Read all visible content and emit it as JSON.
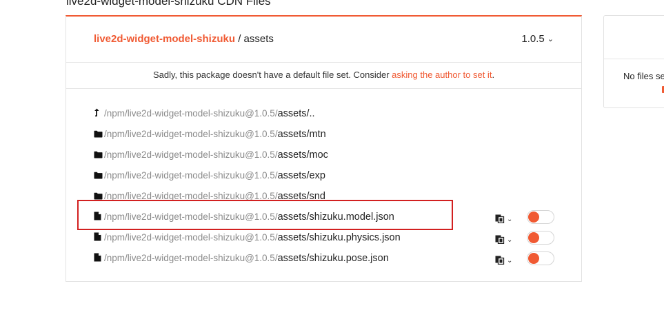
{
  "page": {
    "title": "live2d-widget-model-shizuku CDN Files"
  },
  "header": {
    "package_name": "live2d-widget-model-shizuku",
    "separator": " / ",
    "folder": "assets",
    "version": "1.0.5"
  },
  "notice": {
    "text": "Sadly, this package doesn't have a default file set. Consider ",
    "link_text": "asking the author to set it",
    "suffix": "."
  },
  "files": [
    {
      "type": "parent",
      "icon": "level-up-icon",
      "prefix": "/npm/live2d-widget-model-shizuku@1.0.5/",
      "name": "assets/.."
    },
    {
      "type": "folder",
      "icon": "folder-icon",
      "prefix": "/npm/live2d-widget-model-shizuku@1.0.5/",
      "name": "assets/mtn"
    },
    {
      "type": "folder",
      "icon": "folder-icon",
      "prefix": "/npm/live2d-widget-model-shizuku@1.0.5/",
      "name": "assets/moc"
    },
    {
      "type": "folder",
      "icon": "folder-icon",
      "prefix": "/npm/live2d-widget-model-shizuku@1.0.5/",
      "name": "assets/exp"
    },
    {
      "type": "folder",
      "icon": "folder-icon",
      "prefix": "/npm/live2d-widget-model-shizuku@1.0.5/",
      "name": "assets/snd"
    },
    {
      "type": "file",
      "icon": "file-icon",
      "prefix": "/npm/live2d-widget-model-shizuku@1.0.5/",
      "name": "assets/shizuku.model.json"
    },
    {
      "type": "file",
      "icon": "file-icon",
      "prefix": "/npm/live2d-widget-model-shizuku@1.0.5/",
      "name": "assets/shizuku.physics.json"
    },
    {
      "type": "file",
      "icon": "file-icon",
      "prefix": "/npm/live2d-widget-model-shizuku@1.0.5/",
      "name": "assets/shizuku.pose.json"
    }
  ],
  "side_panel": {
    "message": "No files se"
  },
  "colors": {
    "accent": "#f05a33",
    "highlight": "#d22020",
    "muted_text": "#8a8a8a"
  }
}
